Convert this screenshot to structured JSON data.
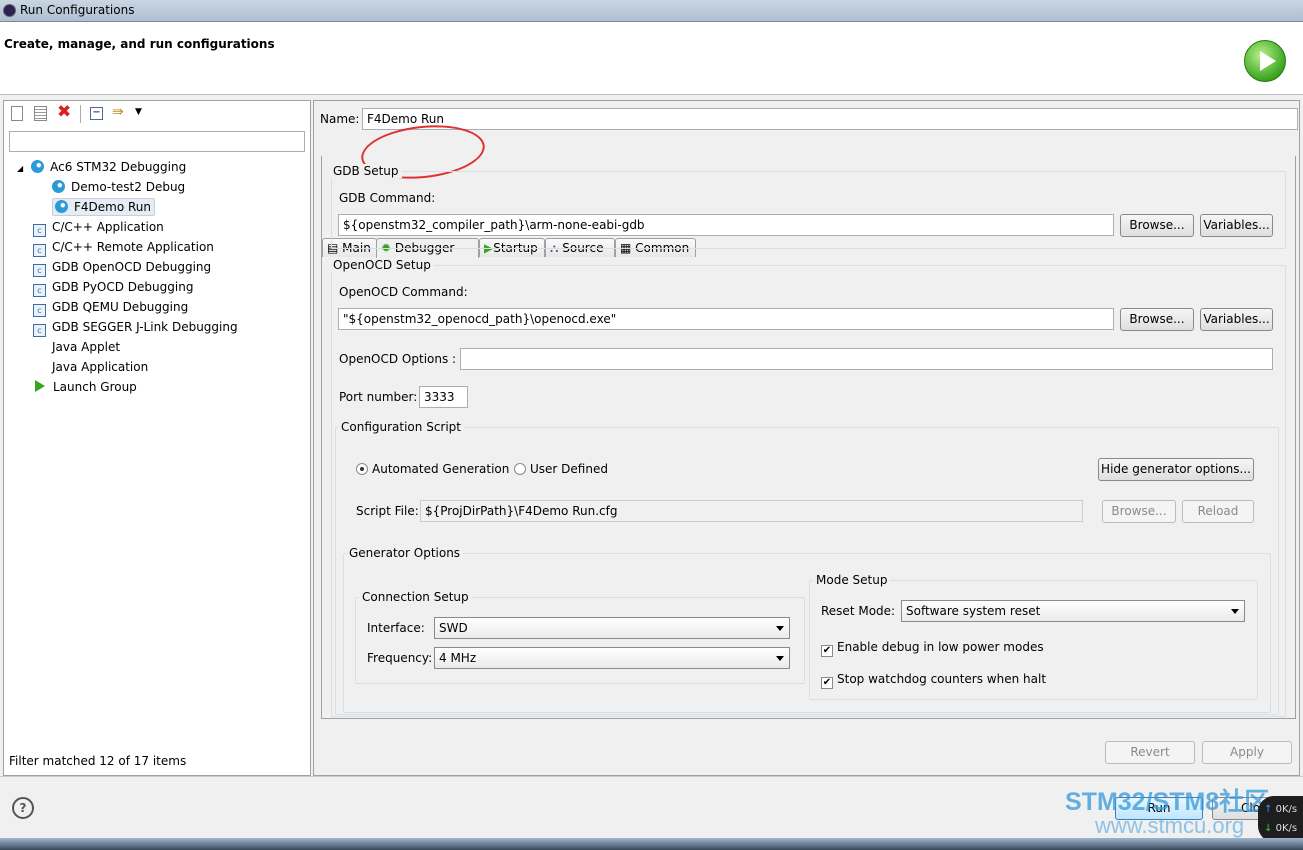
{
  "window": {
    "title": "Run Configurations",
    "header": "Create, manage, and run configurations"
  },
  "sidebar": {
    "filter_placeholder": "",
    "tree": [
      {
        "label": "Ac6 STM32 Debugging",
        "icon": "globe-icon",
        "expanded": true
      },
      {
        "label": "Demo-test2 Debug",
        "icon": "globe-icon"
      },
      {
        "label": "F4Demo Run",
        "icon": "globe-icon",
        "selected": true
      },
      {
        "label": "C/C++ Application",
        "icon": "c-app-icon"
      },
      {
        "label": "C/C++ Remote Application",
        "icon": "c-app-icon"
      },
      {
        "label": "GDB OpenOCD Debugging",
        "icon": "c-app-icon"
      },
      {
        "label": "GDB PyOCD Debugging",
        "icon": "c-app-icon"
      },
      {
        "label": "GDB QEMU Debugging",
        "icon": "c-app-icon"
      },
      {
        "label": "GDB SEGGER J-Link Debugging",
        "icon": "c-app-icon"
      },
      {
        "label": "Java Applet",
        "icon": "java-icon"
      },
      {
        "label": "Java Application",
        "icon": "java-icon"
      },
      {
        "label": "Launch Group",
        "icon": "launch-icon"
      }
    ],
    "status": "Filter matched 12 of 17 items"
  },
  "main": {
    "name_label": "Name:",
    "name_value": "F4Demo Run",
    "tabs": [
      {
        "label": "Main"
      },
      {
        "label": "Debugger",
        "selected": true
      },
      {
        "label": "Startup"
      },
      {
        "label": "Source"
      },
      {
        "label": "Common"
      }
    ],
    "gdb": {
      "title": "GDB Setup",
      "cmd_label": "GDB Command:",
      "cmd_value": "${openstm32_compiler_path}\\arm-none-eabi-gdb",
      "browse": "Browse...",
      "variables": "Variables..."
    },
    "openocd": {
      "title": "OpenOCD Setup",
      "cmd_label": "OpenOCD Command:",
      "cmd_value": "\"${openstm32_openocd_path}\\openocd.exe\"",
      "browse": "Browse...",
      "variables": "Variables...",
      "options_label": "OpenOCD Options :",
      "options_value": "",
      "port_label": "Port number:",
      "port_value": "3333"
    },
    "script": {
      "title": "Configuration Script",
      "auto": "Automated Generation",
      "user": "User Defined",
      "hide": "Hide generator options...",
      "file_label": "Script File:",
      "file_value": "${ProjDirPath}\\F4Demo Run.cfg",
      "browse": "Browse...",
      "reload": "Reload"
    },
    "generator": {
      "title": "Generator Options",
      "conn_title": "Connection Setup",
      "interface_label": "Interface:",
      "interface_value": "SWD",
      "freq_label": "Frequency:",
      "freq_value": "4 MHz",
      "mode_title": "Mode Setup",
      "reset_label": "Reset Mode:",
      "reset_value": "Software system reset",
      "low_power": "Enable debug in low power modes",
      "watchdog": "Stop watchdog counters when halt"
    },
    "revert": "Revert",
    "apply": "Apply"
  },
  "footer": {
    "run": "Run",
    "close": "Close"
  },
  "watermark": {
    "line1": "STM32/STM8社区",
    "line2": "www.stmcu.org"
  },
  "net": {
    "up": "0K/s",
    "down": "0K/s"
  },
  "colors": {
    "annotation": "#e03030",
    "accent": "#3399dd"
  }
}
